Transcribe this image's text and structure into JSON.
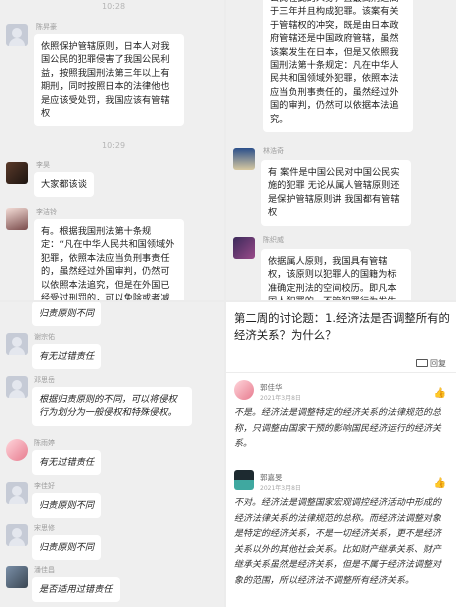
{
  "top_left": {
    "timestamp1": "10:28",
    "msg1": {
      "name": "陈昇豪",
      "text": "依照保护管辖原则，日本人对我国公民的犯罪侵害了我国公民利益，按照我国刑法第三年以上有期刑，同时按照日本的法律他也是应该受处罚，我国应该有管辖权"
    },
    "timestamp2": "10:29",
    "msg2": {
      "name": "李昊",
      "text": "大家都该谈"
    },
    "msg3": {
      "name": "李洁铃",
      "text": "有。根据我国刑法第十条规定：“凡在中华人民共和国领域外犯罪，依照本法应当负刑事责任的，虽然经过外国审判，仍然可以依照本法追究，但是在外国已经受过刑罚的，可以免除或者减轻"
    }
  },
  "top_right": {
    "msg1": {
      "text": "公民在此的人身，且最高刑远高于三年并且构成犯罪。该案有关于管辖权的冲突，既是由日本政府管辖还是中国政府管辖，虽然该案发生在日本，但是又依照我国刑法第十条规定：凡在中华人民共和国领域外犯罪，依照本法应当负刑事责任的，虽然经过外国的审判，仍然可以依据本法追究。"
    },
    "msg2": {
      "name": "林浩奇",
      "text": "有 案件是中国公民对中国公民实施的犯罪 无论从属人管辖原则还是保护管辖原则讲 我国都有管辖权"
    },
    "msg3": {
      "name": "陈织威",
      "text": "依据属人原则，我国具有管辖权，该原则以犯罪人的国籍为标准确定刑法的空间校历。即凡本国人犯罪的，不管犯罪行为发生在"
    }
  },
  "bottom_left": {
    "msg0": {
      "text": "归责原则不同"
    },
    "msg1": {
      "name": "谢宗佑",
      "text": "有无过错责任"
    },
    "msg2": {
      "name": "邓思岳",
      "text": "根据归责原则的不同，可以将侵权行为划分为一般侵权和特殊侵权。"
    },
    "msg3": {
      "name": "陈雨婷",
      "text": "有无过错责任"
    },
    "msg4": {
      "name": "李佳好",
      "text": "归责原则不同"
    },
    "msg5": {
      "name": "宋思修",
      "text": "归责原则不同"
    },
    "msg6": {
      "name": "潘佳昌",
      "text": "是否适用过错责任"
    }
  },
  "bottom_right": {
    "title": "第二周的讨论题：1.经济法是否调整所有的经济关系？为什么？",
    "reply_label": "回复",
    "comment1": {
      "name": "郭佳华",
      "date": "2021年3月8日",
      "text": "不是。经济法是调整特定的经济关系的法律规范的总称，只调整由国家干预的影响国民经济运行的经济关系。"
    },
    "comment2": {
      "name": "郭嘉旻",
      "date": "2021年3月8日",
      "text": "不对。经济法是调整国家宏观调控经济活动中形成的经济法律关系的法律规范的总称。而经济法调整对象是特定的经济关系，不是一切经济关系，更不是经济关系以外的其他社会关系。比如财产继承关系、财产继承关系虽然是经济关系，但是不属于经济法调整对象的范围，所以经济法不调整所有经济关系。"
    }
  }
}
